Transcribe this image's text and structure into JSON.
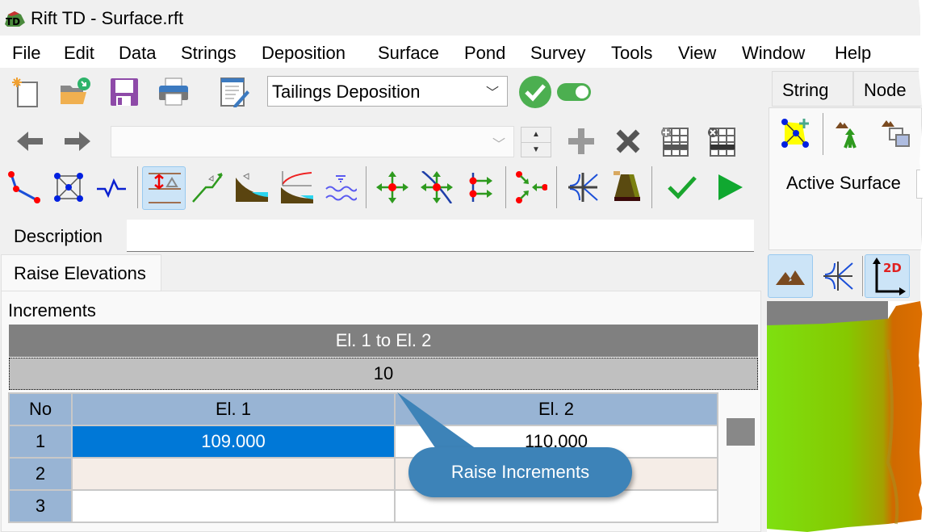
{
  "window": {
    "title": "Rift TD - Surface.rft",
    "app_icon": "rift-td-logo-icon"
  },
  "menu": [
    "File",
    "Edit",
    "Data",
    "Strings",
    "Deposition",
    "Surface",
    "Pond",
    "Survey",
    "Tools",
    "View",
    "Window",
    "Help"
  ],
  "toolbar1": {
    "icons": [
      "new-file-icon",
      "open-folder-icon",
      "save-icon",
      "print-icon",
      "edit-notes-icon"
    ],
    "mode_select": {
      "value": "Tailings Deposition"
    },
    "valid_icon": "green-check-circle-icon",
    "toggle": {
      "state": "on"
    }
  },
  "toolbar2": {
    "icons": [
      "back-arrow-icon",
      "forward-arrow-icon"
    ],
    "nav_select": {
      "value": ""
    },
    "action_icons": [
      "add-icon",
      "delete-icon",
      "insert-row-icon",
      "delete-row-icon"
    ]
  },
  "toolbar3": {
    "icons": [
      "string-line-icon",
      "mesh-nodes-icon",
      "profile-line-icon",
      "raise-elevations-icon",
      "ramp-up-icon",
      "beach-slope-icon",
      "beach-curve-icon",
      "water-level-icon",
      "move-node-icon",
      "move-node-on-string-icon",
      "offset-nodes-icon",
      "merge-nodes-icon",
      "intersect-strings-icon",
      "embankment-icon",
      "apply-check-icon",
      "run-play-icon"
    ],
    "active": "raise-elevations-icon"
  },
  "description": {
    "label": "Description",
    "value": ""
  },
  "tabs": [
    {
      "label": "Raise Elevations",
      "active": true
    }
  ],
  "increments": {
    "label": "Increments",
    "band_header": "El. 1 to El. 2",
    "band_value": "10",
    "columns": [
      "No",
      "El. 1",
      "El. 2"
    ],
    "rows": [
      {
        "no": "1",
        "el1": "109.000",
        "el2": "110.000"
      },
      {
        "no": "2",
        "el1": "",
        "el2": ""
      },
      {
        "no": "3",
        "el1": "",
        "el2": ""
      }
    ]
  },
  "callout": {
    "text": "Raise Increments"
  },
  "right_panel": {
    "tabs": [
      "String",
      "Node"
    ],
    "icons": [
      "add-surface-node-icon",
      "merge-surface-icon",
      "copy-surface-icon"
    ],
    "active_surface_label": "Active Surface",
    "view_buttons": [
      "surface-view-icon",
      "intersect-view-icon",
      "2d-view-icon"
    ],
    "view_2d_label": "2D"
  },
  "colors": {
    "accent": "#0078d7",
    "header": "#98b4d4",
    "callout": "#3d83b8",
    "band_dark": "#808080",
    "band_light": "#c0c0c0"
  }
}
